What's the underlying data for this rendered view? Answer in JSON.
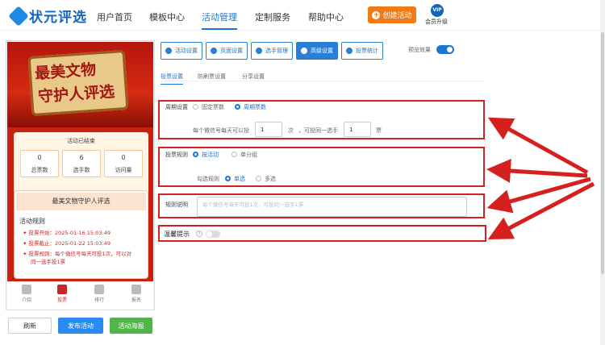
{
  "brand": {
    "name": "状元评选"
  },
  "nav": {
    "items": [
      "用户首页",
      "模板中心",
      "活动管理",
      "定制服务",
      "帮助中心"
    ],
    "active": "活动管理"
  },
  "header": {
    "create_label": "创建活动",
    "vip_badge": "VIP",
    "vip_label": "会员升级"
  },
  "preview": {
    "banner_line1": "最美文物",
    "banner_line2": "守护人评选",
    "status": "活动已结束",
    "stats": [
      {
        "value": "0",
        "label": "总票数"
      },
      {
        "value": "6",
        "label": "选手数"
      },
      {
        "value": "0",
        "label": "访问量"
      }
    ],
    "event_title": "最美文物守护人评选",
    "rules_heading": "活动规则",
    "rules": [
      "投票开始：2025-01-16 15:03:49",
      "投票截止：2025-01-22 15:03:49",
      "投票规则：每个微信号每天可投1次，可以对",
      "同一选手投1票"
    ],
    "tabs": [
      "介绍",
      "投票",
      "排行",
      "报名"
    ],
    "active_tab": "投票"
  },
  "bottom_buttons": {
    "refresh": "刷新",
    "publish": "发布活动",
    "poster": "活动海报"
  },
  "toolbar": {
    "buttons": [
      "活动设置",
      "页面设置",
      "选手管理",
      "高级设置",
      "投票统计"
    ],
    "active": "高级设置",
    "preview_label": "预览效果"
  },
  "subtabs": {
    "items": [
      "投票设置",
      "防刷票设置",
      "分享设置"
    ],
    "active": "投票设置"
  },
  "vote_settings": {
    "period_label": "周期设置",
    "period_options": [
      "固定票数",
      "周期票数"
    ],
    "period_selected": "周期票数",
    "per_day_prefix": "每个微信号每天可以投",
    "per_day_value": "1",
    "per_day_unit": "次",
    "per_player_prefix": "，可投同一选手",
    "per_player_value": "1",
    "per_player_unit": "票",
    "rule_label": "投票规则",
    "rule_options": [
      "按活动",
      "单分组"
    ],
    "rule_selected": "按活动",
    "check_label": "勾选规则",
    "check_options": [
      "单选",
      "多选"
    ],
    "check_selected": "单选",
    "desc_label": "规则说明",
    "desc_placeholder": "每个微信号每天可投1次，可投同一选手1票",
    "tips_label": "温馨提示",
    "tips_help": "?"
  },
  "colors": {
    "accent": "#1976d2",
    "orange": "#f07a18",
    "highlight": "#d61f1f",
    "banner": "#c9200f",
    "green": "#52b54b"
  }
}
